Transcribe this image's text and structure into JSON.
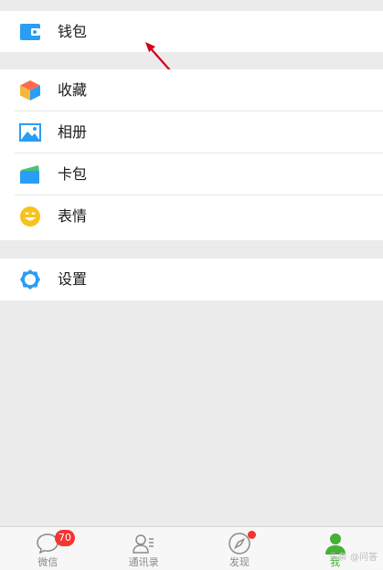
{
  "menu": {
    "wallet": {
      "label": "钱包",
      "icon": "wallet-icon"
    },
    "favorites": {
      "label": "收藏",
      "icon": "cube-icon"
    },
    "album": {
      "label": "相册",
      "icon": "photo-icon"
    },
    "cards": {
      "label": "卡包",
      "icon": "card-icon"
    },
    "stickers": {
      "label": "表情",
      "icon": "smiley-icon"
    },
    "settings": {
      "label": "设置",
      "icon": "gear-icon"
    }
  },
  "tabbar": {
    "tabs": [
      {
        "label": "微信",
        "icon": "chat-bubble-icon",
        "badge": "70"
      },
      {
        "label": "通讯录",
        "icon": "contacts-icon"
      },
      {
        "label": "发现",
        "icon": "compass-icon"
      },
      {
        "label": "我",
        "icon": "person-icon",
        "active": true
      }
    ]
  },
  "watermark": "头条 @问答",
  "colors": {
    "accent_green": "#45b035",
    "badge_red": "#f43530",
    "icon_blue": "#2a9df4",
    "background": "#ebebeb",
    "annotation_arrow": "#d0021b"
  }
}
